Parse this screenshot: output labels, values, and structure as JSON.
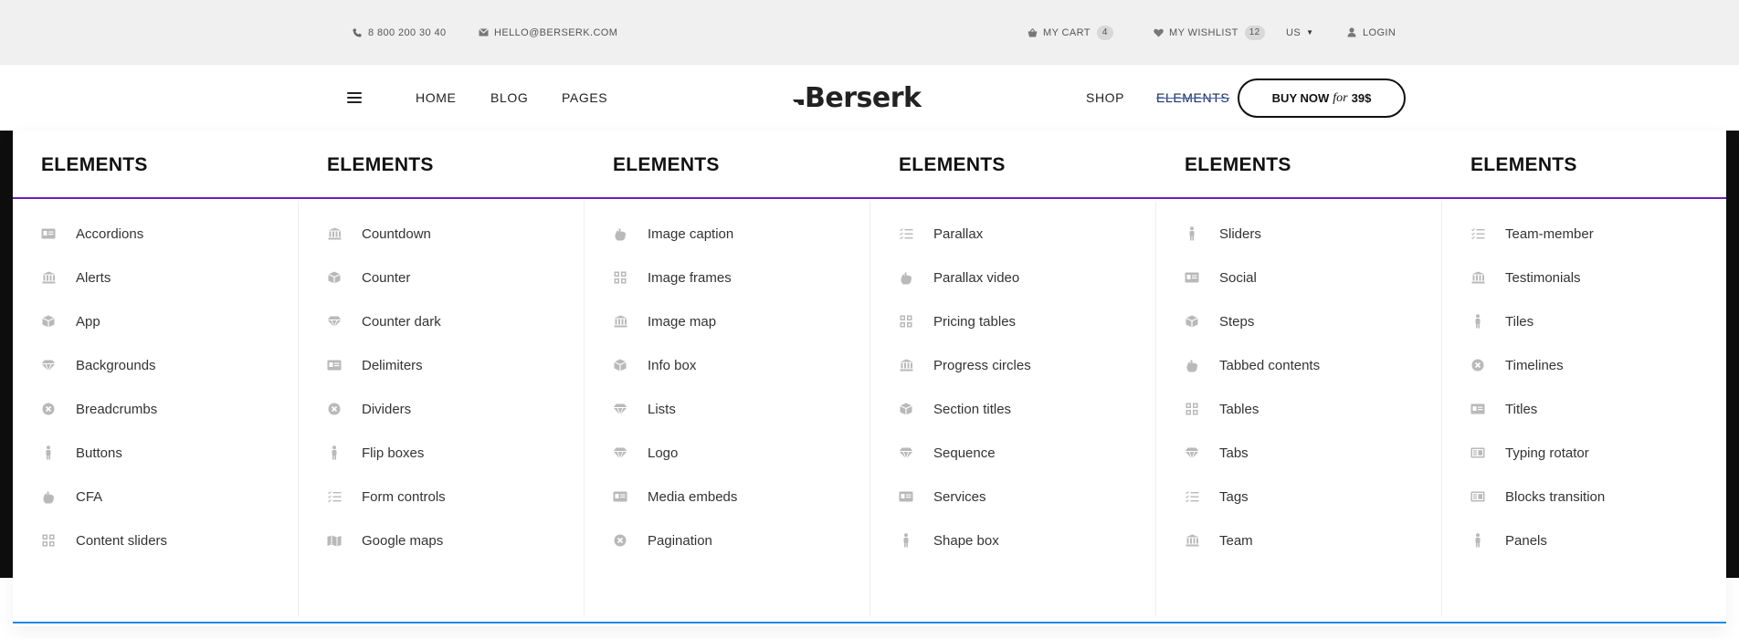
{
  "topbar": {
    "phone": "8 800 200 30 40",
    "email": "HELLO@BERSERK.COM",
    "cart_label": "MY CART",
    "cart_count": "4",
    "wishlist_label": "MY WISHLIST",
    "wishlist_count": "12",
    "currency": "US",
    "login": "LOGIN"
  },
  "header": {
    "nav_left": [
      "HOME",
      "BLOG",
      "PAGES"
    ],
    "logo": "Berserk",
    "nav_right": [
      "SHOP",
      "ELEMENTS"
    ],
    "buy_now": {
      "pre": "BUY NOW",
      "mid": "for",
      "post": "39$"
    }
  },
  "colors": {
    "menu_divider": "#6a1fb4",
    "menu_bottom_border": "#1b8ae8",
    "active_nav_strike": "#3464c6",
    "icon_grey": "#b9b9b9"
  },
  "mega_menu": {
    "columns": [
      {
        "title": "ELEMENTS",
        "items": [
          {
            "label": "Accordions",
            "icon": "id-card-icon"
          },
          {
            "label": "Alerts",
            "icon": "bank-icon"
          },
          {
            "label": "App",
            "icon": "cube-icon"
          },
          {
            "label": "Backgrounds",
            "icon": "diamond-icon"
          },
          {
            "label": "Breadcrumbs",
            "icon": "circle-x-icon"
          },
          {
            "label": "Buttons",
            "icon": "person-icon"
          },
          {
            "label": "CFA",
            "icon": "hand-icon"
          },
          {
            "label": "Content sliders",
            "icon": "grid-icon"
          }
        ]
      },
      {
        "title": "ELEMENTS",
        "items": [
          {
            "label": "Countdown",
            "icon": "bank-icon"
          },
          {
            "label": "Counter",
            "icon": "cube-icon"
          },
          {
            "label": "Counter dark",
            "icon": "diamond-icon"
          },
          {
            "label": "Delimiters",
            "icon": "id-card-icon"
          },
          {
            "label": "Dividers",
            "icon": "circle-x-icon"
          },
          {
            "label": "Flip boxes",
            "icon": "person-icon"
          },
          {
            "label": "Form controls",
            "icon": "list-icon"
          },
          {
            "label": "Google maps",
            "icon": "map-icon"
          }
        ]
      },
      {
        "title": "ELEMENTS",
        "items": [
          {
            "label": "Image caption",
            "icon": "hand-icon"
          },
          {
            "label": "Image frames",
            "icon": "grid-icon"
          },
          {
            "label": "Image map",
            "icon": "bank-icon"
          },
          {
            "label": "Info box",
            "icon": "cube-icon"
          },
          {
            "label": "Lists",
            "icon": "diamond-icon"
          },
          {
            "label": "Logo",
            "icon": "diamond-icon"
          },
          {
            "label": "Media embeds",
            "icon": "id-card-icon"
          },
          {
            "label": "Pagination",
            "icon": "circle-x-icon"
          }
        ]
      },
      {
        "title": "ELEMENTS",
        "items": [
          {
            "label": "Parallax",
            "icon": "list-icon"
          },
          {
            "label": "Parallax video",
            "icon": "hand-icon"
          },
          {
            "label": "Pricing tables",
            "icon": "grid-icon"
          },
          {
            "label": "Progress circles",
            "icon": "bank-icon"
          },
          {
            "label": "Section titles",
            "icon": "cube-icon"
          },
          {
            "label": "Sequence",
            "icon": "diamond-icon"
          },
          {
            "label": "Services",
            "icon": "id-card-icon"
          },
          {
            "label": "Shape box",
            "icon": "person-icon"
          }
        ]
      },
      {
        "title": "ELEMENTS",
        "items": [
          {
            "label": "Sliders",
            "icon": "person-icon"
          },
          {
            "label": "Social",
            "icon": "id-card-icon"
          },
          {
            "label": "Steps",
            "icon": "cube-icon"
          },
          {
            "label": "Tabbed contents",
            "icon": "hand-icon"
          },
          {
            "label": "Tables",
            "icon": "grid-icon"
          },
          {
            "label": "Tabs",
            "icon": "diamond-icon"
          },
          {
            "label": "Tags",
            "icon": "list-icon"
          },
          {
            "label": "Team",
            "icon": "bank-icon"
          }
        ]
      },
      {
        "title": "ELEMENTS",
        "items": [
          {
            "label": "Team-member",
            "icon": "list-icon"
          },
          {
            "label": "Testimonials",
            "icon": "bank-icon"
          },
          {
            "label": "Tiles",
            "icon": "person-icon"
          },
          {
            "label": "Timelines",
            "icon": "circle-x-icon"
          },
          {
            "label": "Titles",
            "icon": "id-card-icon"
          },
          {
            "label": "Typing rotator",
            "icon": "ad-icon"
          },
          {
            "label": "Blocks transition",
            "icon": "ad-icon"
          },
          {
            "label": "Panels",
            "icon": "person-icon"
          }
        ]
      }
    ]
  }
}
